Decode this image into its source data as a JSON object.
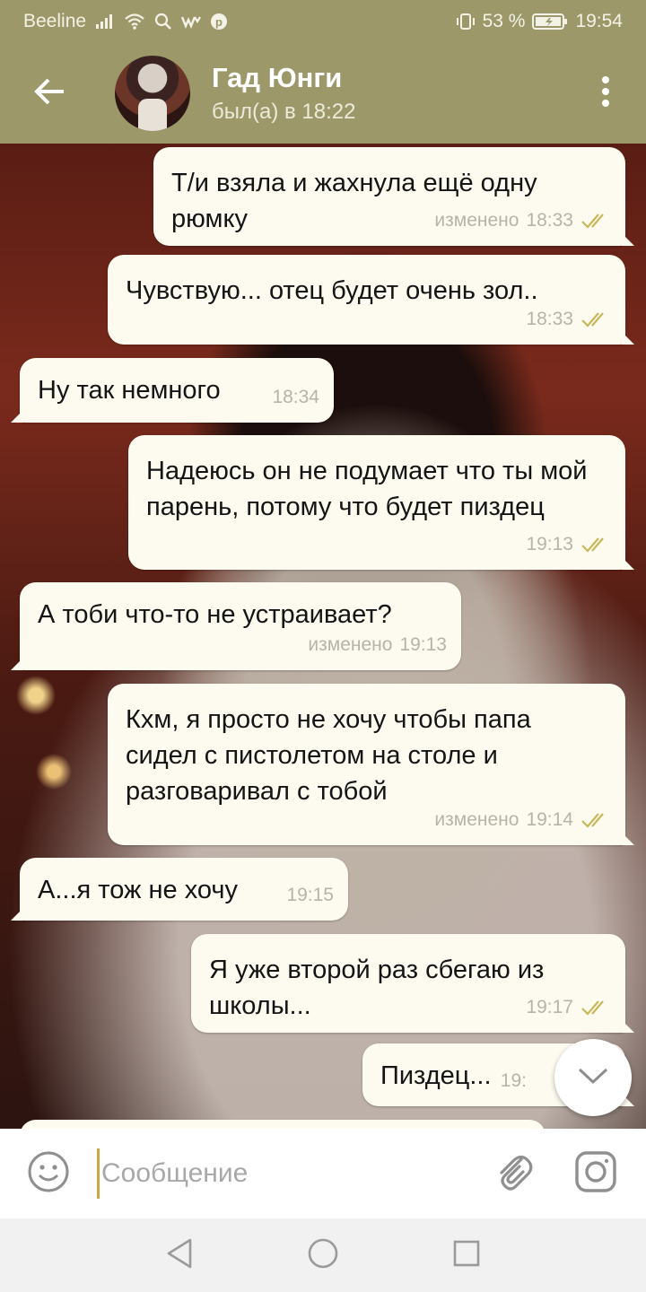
{
  "status_bar": {
    "carrier": "Beeline",
    "battery": "53 %",
    "time": "19:54"
  },
  "header": {
    "contact_name": "Гад Юнги",
    "contact_status": "был(а) в 18:22"
  },
  "messages": [
    {
      "direction": "out",
      "text": "Т/и взяла и жахнула ещё одну рюмку",
      "edited": "изменено",
      "time": "18:33",
      "read": true
    },
    {
      "direction": "out",
      "text": "Чувствую... отец будет очень зол..",
      "edited": "",
      "time": "18:33",
      "read": true
    },
    {
      "direction": "in",
      "text": "Ну так немного",
      "edited": "",
      "time": "18:34",
      "read": false
    },
    {
      "direction": "out",
      "text": "Надеюсь он не подумает что ты мой парень, потому что будет пиздец",
      "edited": "",
      "time": "19:13",
      "read": true
    },
    {
      "direction": "in",
      "text": "А тоби что-то не устраивает?",
      "edited": "изменено",
      "time": "19:13",
      "read": false
    },
    {
      "direction": "out",
      "text": "Кхм, я просто не хочу чтобы папа сидел с пистолетом на столе и разговаривал с тобой",
      "edited": "изменено",
      "time": "19:14",
      "read": true
    },
    {
      "direction": "in",
      "text": "А...я тож не хочу",
      "edited": "",
      "time": "19:15",
      "read": false
    },
    {
      "direction": "out",
      "text": "Я уже второй раз сбегаю из школы...",
      "edited": "",
      "time": "19:17",
      "read": true
    },
    {
      "direction": "out",
      "text": "Пиздец...",
      "edited": "",
      "time": "19:",
      "read": false
    }
  ],
  "composer": {
    "placeholder": "Сообщение",
    "value": ""
  },
  "colors": {
    "header_bg": "#9c9869",
    "bubble_bg": "#fdfbf0",
    "check_color": "#c7b85a",
    "meta_text": "#b6b4a6"
  },
  "icons": {
    "back": "arrow-left-icon",
    "menu": "more-vertical-icon",
    "scroll_down": "chevron-down-icon",
    "emoji": "smiley-icon",
    "attach": "paperclip-icon",
    "camera": "camera-icon",
    "read": "double-check-icon"
  }
}
